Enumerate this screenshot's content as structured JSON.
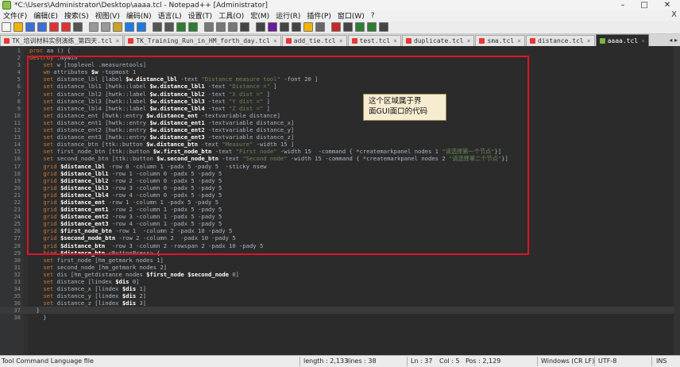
{
  "window": {
    "title": "*C:\\Users\\Administrator\\Desktop\\aaaa.tcl - Notepad++ [Administrator]"
  },
  "menu": [
    "文件(F)",
    "编辑(E)",
    "搜索(S)",
    "视图(V)",
    "编码(N)",
    "语言(L)",
    "设置(T)",
    "工具(O)",
    "宏(M)",
    "运行(R)",
    "插件(P)",
    "窗口(W)",
    "?"
  ],
  "menu_close": "X",
  "toolbar_icons": [
    "new-icon",
    "open-icon",
    "save-icon",
    "save-all-icon",
    "close-icon",
    "close-all-icon",
    "print-icon",
    "cut-icon",
    "copy-icon",
    "paste-icon",
    "undo-icon",
    "redo-icon",
    "find-icon",
    "replace-icon",
    "zoom-in-icon",
    "zoom-out-icon",
    "sync-v-icon",
    "sync-h-icon",
    "wrap-icon",
    "all-chars-icon",
    "indent-guide-icon",
    "lang-icon",
    "doc-map-icon",
    "func-list-icon",
    "folder-icon",
    "monitor-icon",
    "record-icon",
    "stop-icon",
    "play-icon",
    "play-multi-icon",
    "save-macro-icon"
  ],
  "tabs": [
    {
      "label": "TK_培训材料实例演练_第四天.tcl",
      "active": false
    },
    {
      "label": "TK_Training_Run_in_HM_forth_day.tcl",
      "active": false
    },
    {
      "label": "add_tie.tcl",
      "active": false
    },
    {
      "label": "test.tcl",
      "active": false
    },
    {
      "label": "duplicate.tcl",
      "active": false
    },
    {
      "label": "sma.tcl",
      "active": false
    },
    {
      "label": "distance.tcl",
      "active": false
    },
    {
      "label": "aaaa.tcl",
      "active": true
    }
  ],
  "tab_arrows": "◂ ▸",
  "code_lines": [
    "proc aa () {",
    "destroy .mywin",
    "    set w [toplevel .measuretools]",
    "    wm attributes $w -topmost 1",
    "    set distance_lbl [label $w.distance_lbl -text \"Distance measure tool\" -font 20 ]",
    "    set distance_lbl1 [hwtk::label $w.distance_lbl1 -text \"Distance =\" ]",
    "    set distance_lbl2 [hwtk::label $w.distance_lbl2 -text \"X dist =\" ]",
    "    set distance_lbl3 [hwtk::label $w.distance_lbl3 -text \"Y dist =\" ]",
    "    set distance_lbl4 [hwtk::label $w.distance_lbl4 -text \"Z dist =\" ]",
    "    set distance_ent [hwtk::entry $w.distance_ent -textvariable distance]",
    "    set distance_ent1 [hwtk::entry $w.distance_ent1 -textvariable distance_x]",
    "    set distance_ent2 [hwtk::entry $w.distance_ent2 -textvariable distance_y]",
    "    set distance_ent3 [hwtk::entry $w.distance_ent3 -textvariable distance_z]",
    "    set distance_btn [ttk::button $w.distance_btn -text \"Measure\" -width 15 ]",
    "    set first_node_btn [ttk::button $w.first_node_btn -text \"First node\" -width 15  -command { *createmarkpanel nodes 1 \"请选择第一个节点\"}]",
    "    set second_node_btn [ttk::button $w.second_node_btn -text \"Second node\" -width 15 -command { *createmarkpanel nodes 2 \"请选择第二个节点\"}]",
    "    grid $distance_lbl -row 0 -column 1 -padx 5 -pady 5  -sticky nsew",
    "    grid $distance_lbl1 -row 1 -column 0 -padx 5 -pady 5",
    "    grid $distance_lbl2 -row 2 -column 0 -padx 5 -pady 5",
    "    grid $distance_lbl3 -row 3 -column 0 -padx 5 -pady 5",
    "    grid $distance_lbl4 -row 4 -column 0 -padx 5 -pady 5",
    "    grid $distance_ent -row 1 -column 1 -padx 5 -pady 5",
    "    grid $distance_ent1 -row 2 -column 1 -padx 5 -pady 5",
    "    grid $distance_ent2 -row 3 -column 1 -padx 5 -pady 5",
    "    grid $distance_ent3 -row 4 -column 1 -padx 5 -pady 5",
    "    grid $first_node_btn -row 1  -column 2 -padx 10 -pady 5",
    "    grid $second_node_btn -row 2 -column 2  -padx 10 -pady 5",
    "    grid $distance_btn  -row 3 -column 2 -rowspan 2 -padx 10 -pady 5",
    "    bind $distance_btn <ButtonPress> {",
    "    set first_node [hm_getmark nodes 1]",
    "    set second_node [hm_getmark nodes 2]",
    "    set dis [hm_getdistance nodes $first_node $second_node 0]",
    "    set distance [lindex $dis 0]",
    "    set distance_x [lindex $dis 1]",
    "    set distance_y [lindex $dis 2]",
    "    set distance_z [lindex $dis 3]",
    "  }",
    "    }"
  ],
  "annotation": {
    "line1": "这个区域属于界",
    "line2": "面GUI面口的代码"
  },
  "status": {
    "language": "Tool Command Language file",
    "length": "length : 2,133",
    "lines": "lines : 38",
    "ln": "Ln : 37",
    "col": "Col : 5",
    "pos": "Pos : 2,129",
    "eol": "Windows (CR LF)",
    "encoding": "UTF-8",
    "mode": "INS"
  },
  "colors": {
    "editor_bg": "#2b2b2b",
    "annotation_border": "#e0142a",
    "note_bg": "#f7ecd0"
  }
}
